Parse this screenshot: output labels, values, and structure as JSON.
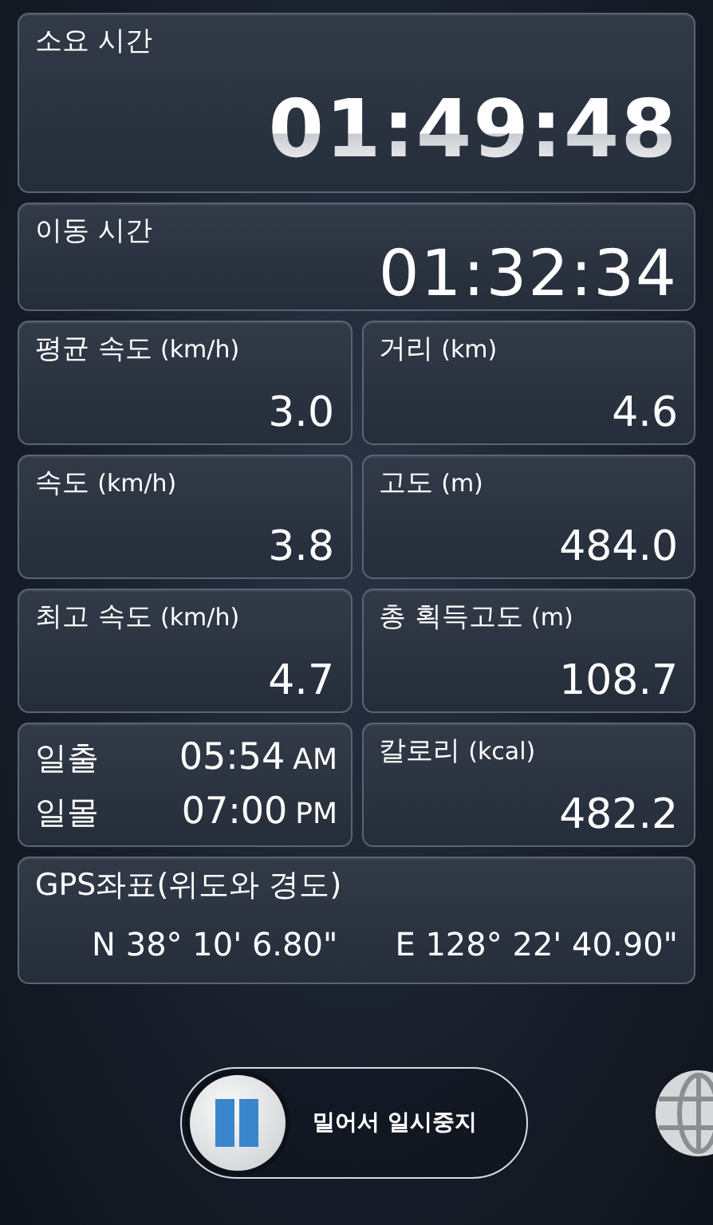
{
  "elapsed": {
    "label": "소요 시간",
    "value": "01:49:48",
    "kind": "big"
  },
  "moving": {
    "label": "이동 시간",
    "value": "01:32:34",
    "kind": "medium"
  },
  "cells": [
    {
      "kind": "stat",
      "label": "평균 속도",
      "unit": "(km/h)",
      "value": "3.0"
    },
    {
      "kind": "stat",
      "label": "거리",
      "unit": "(km)",
      "value": "4.6"
    },
    {
      "kind": "stat",
      "label": "속도",
      "unit": "(km/h)",
      "value": "3.8"
    },
    {
      "kind": "stat",
      "label": "고도",
      "unit": "(m)",
      "value": "484.0"
    },
    {
      "kind": "stat",
      "label": "최고 속도",
      "unit": "(km/h)",
      "value": "4.7"
    },
    {
      "kind": "stat",
      "label": "총 획득고도",
      "unit": "(m)",
      "value": "108.7"
    },
    {
      "kind": "sun",
      "rows": [
        {
          "label": "일출",
          "time": "05:54",
          "ampm": "AM"
        },
        {
          "label": "일몰",
          "time": "07:00",
          "ampm": "PM"
        }
      ]
    },
    {
      "kind": "stat",
      "label": "칼로리",
      "unit": "(kcal)",
      "value": "482.2"
    }
  ],
  "gps": {
    "label": "GPS좌표(위도와 경도)",
    "latitude": "N 38° 10' 6.80\"",
    "longitude": "E 128° 22' 40.90\""
  },
  "pause_slider": {
    "label": "밀어서 일시중지",
    "level": 0
  }
}
